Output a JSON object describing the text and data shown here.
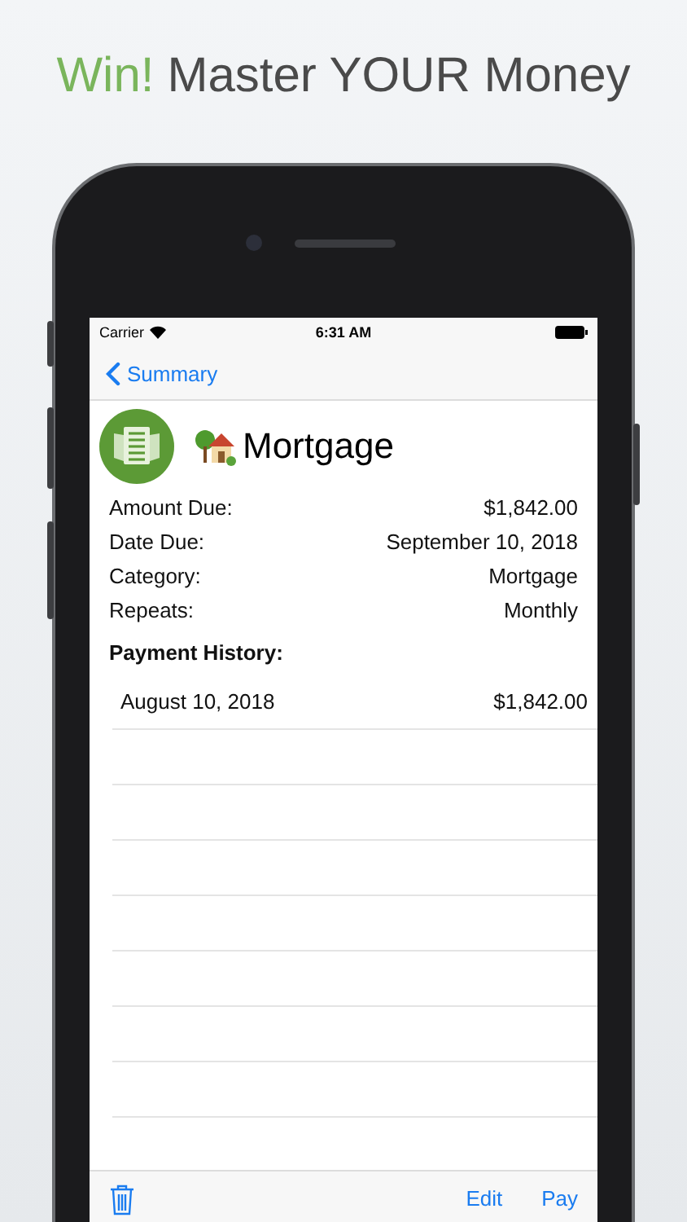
{
  "headline": {
    "accent": "Win!",
    "text": "Master YOUR Money"
  },
  "status_bar": {
    "carrier": "Carrier",
    "time": "6:31 AM"
  },
  "nav_bar": {
    "back": "Summary"
  },
  "bill": {
    "title": "Mortgage"
  },
  "details": [
    {
      "label": "Amount Due:",
      "value": "$1,842.00"
    },
    {
      "label": "Date Due:",
      "value": "September 10, 2018"
    },
    {
      "label": "Category:",
      "value": "Mortgage"
    },
    {
      "label": "Repeats:",
      "value": "Monthly"
    }
  ],
  "history": {
    "heading": "Payment History:",
    "rows": [
      {
        "date": "August 10, 2018",
        "amount": "$1,842.00"
      }
    ]
  },
  "toolbar": {
    "buttons": [
      {
        "label": "Edit"
      },
      {
        "label": "Pay"
      }
    ]
  }
}
